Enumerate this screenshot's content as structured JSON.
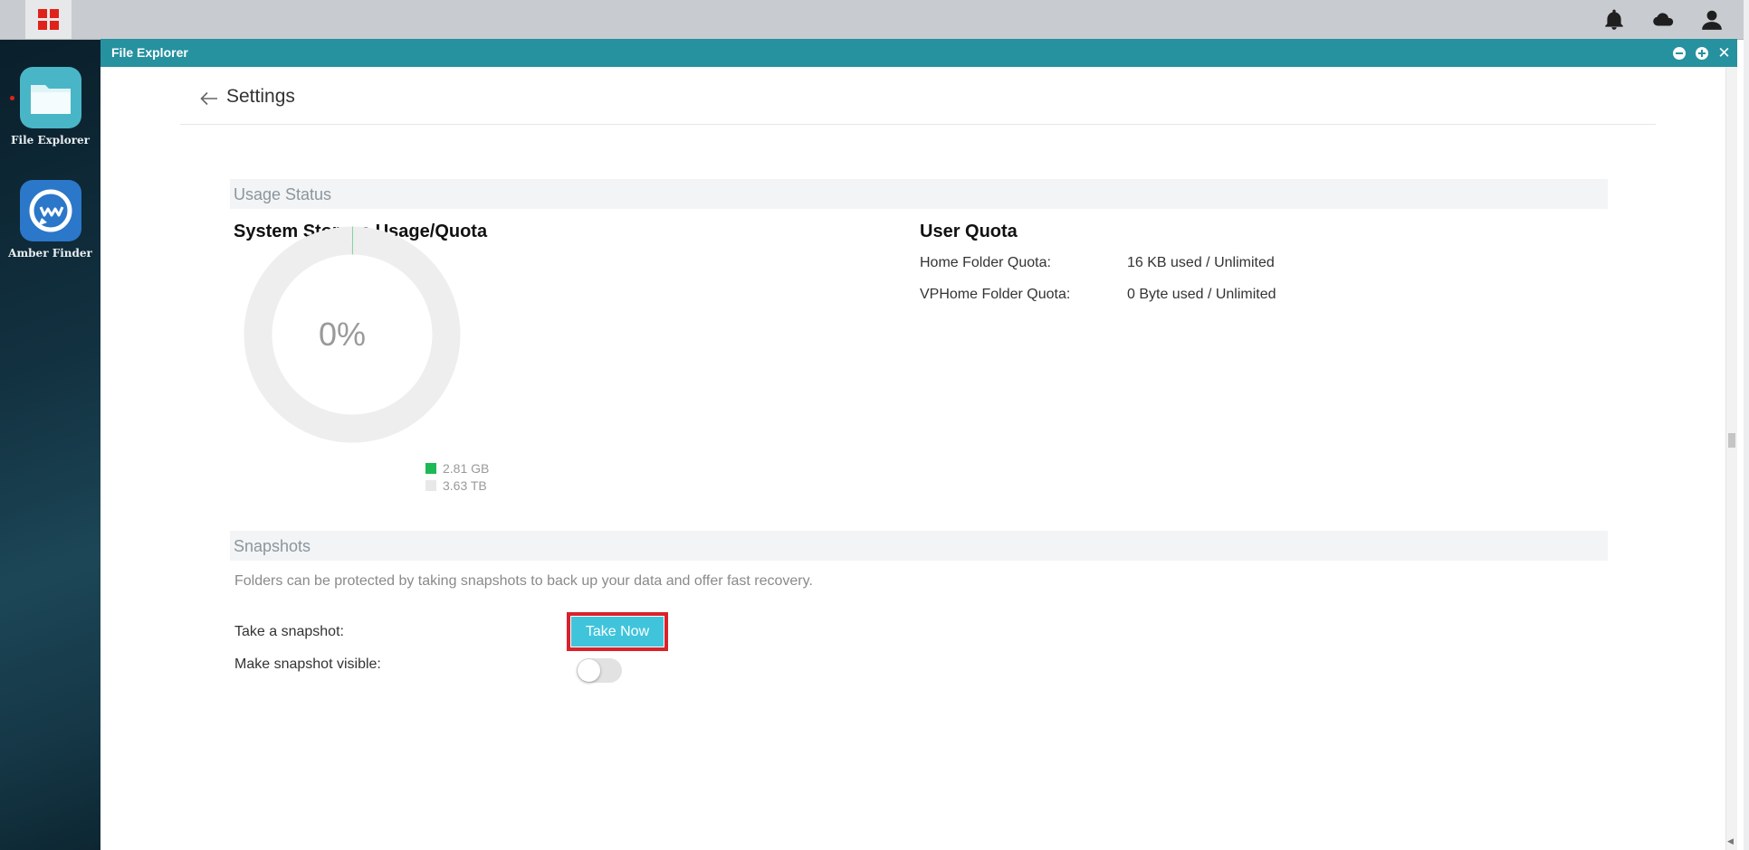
{
  "desktop": {
    "apps": [
      {
        "label": "File Explorer",
        "icon": "folder-icon"
      },
      {
        "label": "Amber Finder",
        "icon": "amber-finder-icon"
      }
    ]
  },
  "topbar": {
    "icons": [
      "start-menu-icon",
      "bell-icon",
      "cloud-icon",
      "user-icon"
    ]
  },
  "window": {
    "title": "File Explorer"
  },
  "settings": {
    "title": "Settings",
    "usage_section": "Usage Status",
    "system_storage_title": "System Storage Usage/Quota",
    "donut_percent": "0%",
    "used_fraction": 0.0008,
    "legend": [
      {
        "label": "2.81 GB",
        "color": "#1db954"
      },
      {
        "label": "3.63 TB",
        "color": "#e8e8e8"
      }
    ],
    "user_quota_title": "User Quota",
    "quotas": [
      {
        "label": "Home Folder Quota:",
        "value": "16 KB used / Unlimited"
      },
      {
        "label": "VPHome Folder Quota:",
        "value": "0 Byte used / Unlimited"
      }
    ],
    "snapshots_section": "Snapshots",
    "snapshots_desc": "Folders can be protected by taking snapshots to back up your data and offer fast recovery.",
    "take_snapshot_label": "Take a snapshot:",
    "take_now_button": "Take Now",
    "make_visible_label": "Make snapshot visible:",
    "make_visible_on": false
  },
  "colors": {
    "titlebar": "#26919f",
    "accent_button": "#40c4dc",
    "highlight_border": "#d9222a"
  }
}
